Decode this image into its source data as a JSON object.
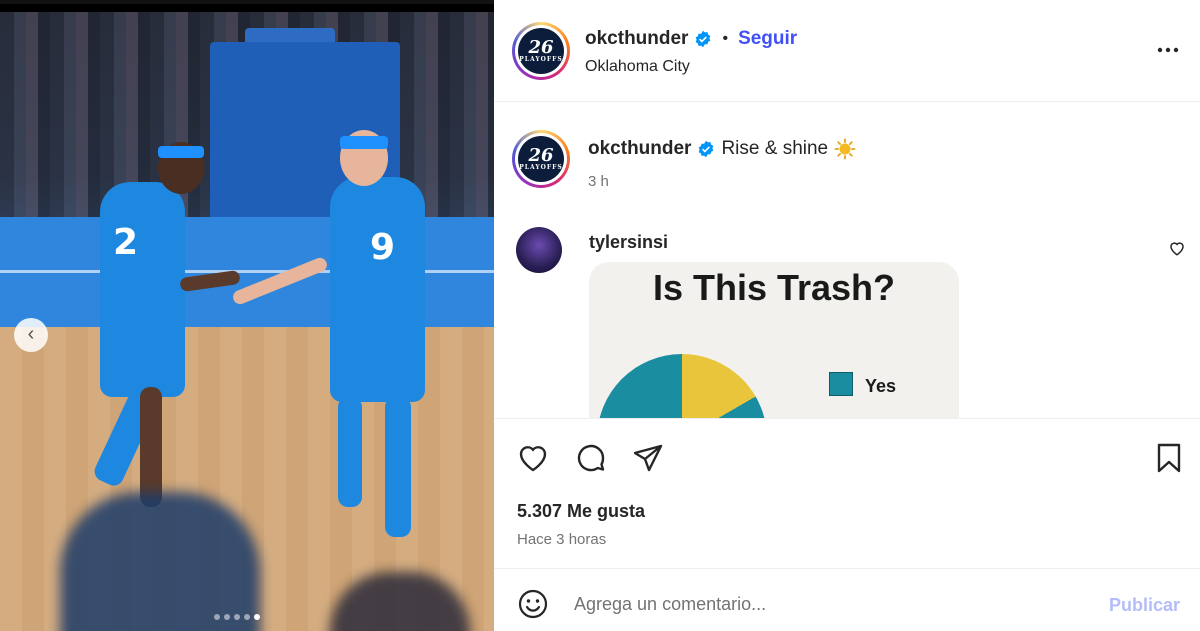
{
  "post": {
    "username": "okcthunder",
    "verified": true,
    "follow_label": "Seguir",
    "separator": "•",
    "location": "Oklahoma City",
    "avatar_text": "26",
    "avatar_subtext": "PLAYOFFS"
  },
  "media": {
    "jersey_left": "2",
    "jersey_right": "9",
    "carousel_dots": 5,
    "active_dot": 4
  },
  "caption": {
    "username": "okcthunder",
    "text": "Rise & shine",
    "time": "3 h"
  },
  "comment": {
    "username": "tylersinsi",
    "image": {
      "title": "Is This Trash?",
      "legend_label": "Yes"
    }
  },
  "engagement": {
    "likes": "5.307 Me gusta",
    "posted": "Hace 3 horas"
  },
  "add_comment": {
    "placeholder": "Agrega un comentario...",
    "publish_label": "Publicar"
  },
  "colors": {
    "follow": "#4150f7",
    "publish_disabled": "#b4bdf9",
    "verified": "#0095f6"
  },
  "icons": [
    "chevron-left-icon",
    "more-icon",
    "verified-icon",
    "sun-emoji-icon",
    "heart-icon",
    "comment-icon",
    "share-icon",
    "bookmark-icon",
    "emoji-icon"
  ]
}
